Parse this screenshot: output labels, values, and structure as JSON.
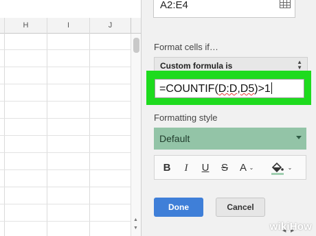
{
  "sheet": {
    "columns": [
      "H",
      "I",
      "J"
    ]
  },
  "panel": {
    "range_value": "A2:E4",
    "format_cells_label": "Format cells if…",
    "condition_select": "Custom formula is",
    "formula_parts": {
      "prefix": "=",
      "fn": "COUNTIF",
      "open": "(",
      "ref1": "D:D",
      "comma": ",",
      "ref2": "D5",
      "suffix": ")>1"
    },
    "formatting_style_label": "Formatting style",
    "style_select": "Default",
    "toolbar": {
      "bold": "B",
      "italic": "I",
      "underline": "U",
      "strikethrough": "S",
      "text_color": "A"
    },
    "done_label": "Done",
    "cancel_label": "Cancel"
  },
  "watermark": {
    "part1": "wiki",
    "part2": "How"
  },
  "colors": {
    "highlight": "#1edb1e",
    "done_button": "#3f7fd8",
    "style_preview": "#93c4a7"
  }
}
